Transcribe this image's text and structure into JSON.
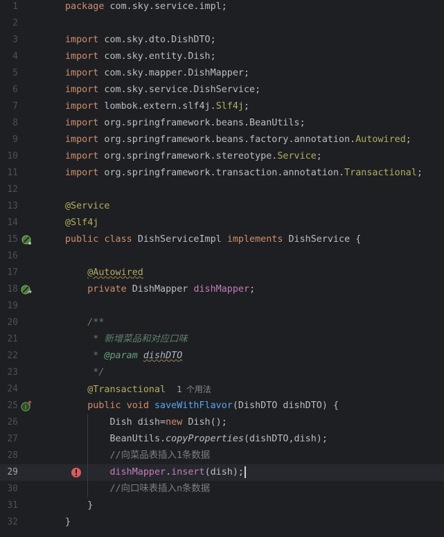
{
  "editor": {
    "line_numbers": [
      "1",
      "2",
      "3",
      "4",
      "5",
      "6",
      "7",
      "8",
      "9",
      "10",
      "11",
      "12",
      "13",
      "14",
      "15",
      "16",
      "17",
      "18",
      "19",
      "20",
      "21",
      "22",
      "23",
      "24",
      "25",
      "26",
      "27",
      "28",
      "29",
      "30",
      "31",
      "32"
    ],
    "current_line": "29",
    "usage_hint": {
      "count": "1",
      "label": "个用法"
    }
  },
  "code": {
    "l1": {
      "kw": "package",
      "rest": " com.sky.service.impl;"
    },
    "l3": {
      "kw": "import",
      "rest": " com.sky.dto.DishDTO;"
    },
    "l4": {
      "kw": "import",
      "rest": " com.sky.entity.Dish;"
    },
    "l5": {
      "kw": "import",
      "rest": " com.sky.mapper.DishMapper;"
    },
    "l6": {
      "kw": "import",
      "rest": " com.sky.service.DishService;"
    },
    "l7": {
      "kw": "import",
      "rest": " lombok.extern.slf4j.",
      "ann": "Slf4j",
      "end": ";"
    },
    "l8": {
      "kw": "import",
      "rest": " org.springframework.beans.BeanUtils;"
    },
    "l9": {
      "kw": "import",
      "rest": " org.springframework.beans.factory.annotation.",
      "ann": "Autowired",
      "end": ";"
    },
    "l10": {
      "kw": "import",
      "rest": " org.springframework.stereotype.",
      "ann": "Service",
      "end": ";"
    },
    "l11": {
      "kw": "import",
      "rest": " org.springframework.transaction.annotation.",
      "ann": "Transactional",
      "end": ";"
    },
    "l13": {
      "ann": "@Service"
    },
    "l14": {
      "ann": "@Slf4j"
    },
    "l15": {
      "kw1": "public",
      "kw2": "class",
      "name": "DishServiceImpl",
      "kw3": "implements",
      "rest": "DishService {"
    },
    "l17": {
      "ann": "@Autowired"
    },
    "l18": {
      "kw": "private",
      "type": "DishMapper",
      "field": "dishMapper",
      "end": ";"
    },
    "l20": {
      "doc": "/**"
    },
    "l21": {
      "doc": " * 新增菜品和对应口味"
    },
    "l22": {
      "star": " * ",
      "tag": "@param",
      "param": "dishDTO"
    },
    "l23": {
      "doc": " */"
    },
    "l24": {
      "ann": "@Transactional"
    },
    "l25": {
      "kw1": "public",
      "kw2": "void",
      "fn": "saveWithFlavor",
      "rest": "(DishDTO dishDTO) {"
    },
    "l26": {
      "a": "Dish dish=",
      "kw": "new",
      "b": " Dish();"
    },
    "l27": {
      "a": "BeanUtils.",
      "fn": "copyProperties",
      "b": "(dishDTO,dish);"
    },
    "l28": {
      "cmt": "//向菜品表插入1条数据"
    },
    "l29": {
      "field": "dishMapper",
      "dot": ".",
      "fn": "insert",
      "b": "(dish);"
    },
    "l30": {
      "cmt": "//向口味表插入n条数据"
    },
    "l31": {
      "rest": "}"
    },
    "l32": {
      "rest": "}"
    }
  }
}
